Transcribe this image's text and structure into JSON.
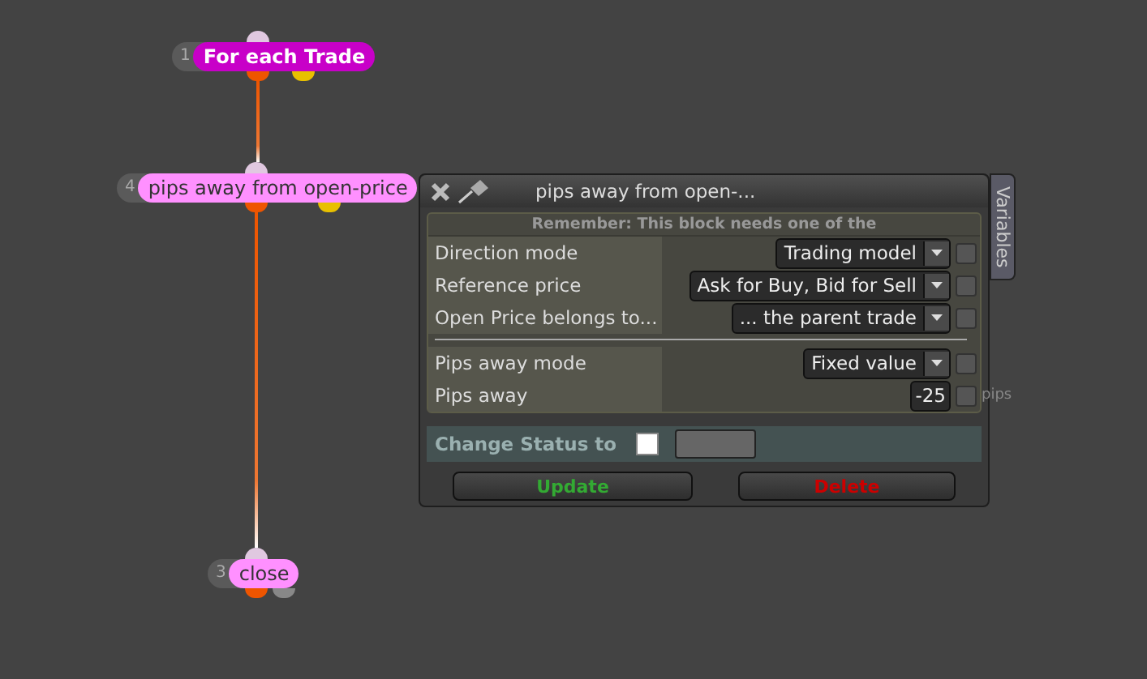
{
  "nodes": [
    {
      "number": "1",
      "label": "For each Trade",
      "selected": true,
      "ports": [
        {
          "color": "#e0c8e0"
        },
        {
          "color": "#ee5500"
        },
        {
          "color": "#e8c000"
        }
      ]
    },
    {
      "number": "4",
      "label": "pips away from open-price",
      "selected": false,
      "ports": [
        {
          "color": "#e0c8e0"
        },
        {
          "color": "#ee5500"
        },
        {
          "color": "#e8c000"
        }
      ]
    },
    {
      "number": "3",
      "label": "close",
      "selected": false,
      "ports": [
        {
          "color": "#e0c8e0"
        },
        {
          "color": "#ee5500"
        },
        {
          "color": "#888888"
        }
      ]
    }
  ],
  "dialog": {
    "title": "pips away from open-...",
    "side_tab": "Variables",
    "reminder": "Remember: This block needs one of the",
    "groups": [
      [
        {
          "label": "Direction mode",
          "kind": "select",
          "value": "Trading model",
          "checked": false
        },
        {
          "label": "Reference price",
          "kind": "select",
          "value": "Ask for Buy, Bid for Sell",
          "checked": false
        },
        {
          "label": "Open Price belongs to...",
          "kind": "select",
          "value": "... the parent trade",
          "checked": false
        }
      ],
      [
        {
          "label": "Pips away mode",
          "kind": "select",
          "value": "Fixed value",
          "checked": false
        },
        {
          "label": "Pips away",
          "kind": "number",
          "value": "-25",
          "checked": false,
          "unit": "pips"
        }
      ]
    ],
    "status": {
      "label": "Change Status to",
      "checked": false
    },
    "buttons": [
      {
        "label": "Update",
        "kind": "confirm"
      },
      {
        "label": "Delete",
        "kind": "danger"
      }
    ]
  }
}
